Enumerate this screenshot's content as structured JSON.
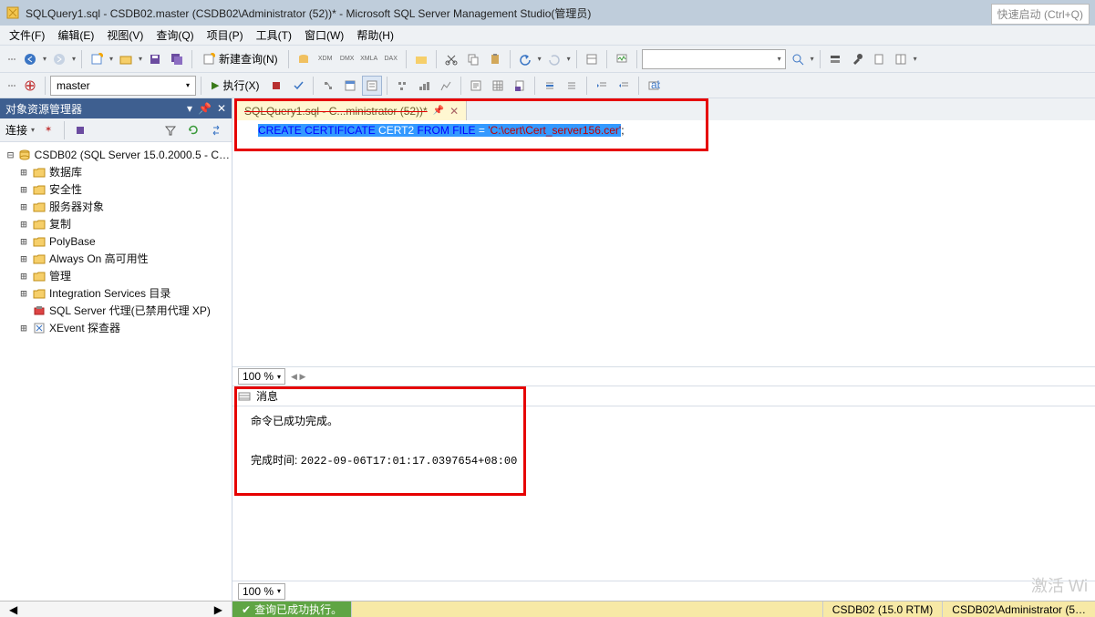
{
  "title": "SQLQuery1.sql - CSDB02.master (CSDB02\\Administrator (52))* - Microsoft SQL Server Management Studio(管理员)",
  "quick_launch": "快速启动 (Ctrl+Q)",
  "menu": {
    "file": "文件(F)",
    "edit": "编辑(E)",
    "view": "视图(V)",
    "query": "查询(Q)",
    "project": "项目(P)",
    "tools": "工具(T)",
    "window": "窗口(W)",
    "help": "帮助(H)"
  },
  "toolbar1": {
    "new_query": "新建查询(N)",
    "search_placeholder": ""
  },
  "toolbar2": {
    "db_selected": "master",
    "execute": "执行(X)"
  },
  "objexp": {
    "title": "对象资源管理器",
    "connect_label": "连接",
    "root": "CSDB02 (SQL Server 15.0.2000.5 - C…",
    "items": [
      "数据库",
      "安全性",
      "服务器对象",
      "复制",
      "PolyBase",
      "Always On 高可用性",
      "管理",
      "Integration Services 目录",
      "SQL Server 代理(已禁用代理 XP)",
      "XEvent 探查器"
    ]
  },
  "tab": {
    "label": "SQLQuery1.sql - C...ministrator (52))*"
  },
  "editor": {
    "zoom": "100 %",
    "sql_full": "CREATE CERTIFICATE CERT2 FROM FILE = 'C:\\cert\\Cert_server156.cer';",
    "sql_kw1": "CREATE",
    "sql_kw2": "CERTIFICATE",
    "sql_ident": "CERT2",
    "sql_kw3": "FROM",
    "sql_kw4": "FILE",
    "sql_eq": "=",
    "sql_str": "'C:\\cert\\Cert_server156.cer'",
    "sql_semi": ";"
  },
  "messages": {
    "tab_label": "消息",
    "line1": "命令已成功完成。",
    "line2_prefix": "完成时间: ",
    "line2_time": "2022-09-06T17:01:17.0397654+08:00",
    "zoom": "100 %"
  },
  "status": {
    "query_ok": "查询已成功执行。",
    "server": "CSDB02 (15.0 RTM)",
    "user": "CSDB02\\Administrator (5…"
  },
  "watermark": "激活 Wi"
}
